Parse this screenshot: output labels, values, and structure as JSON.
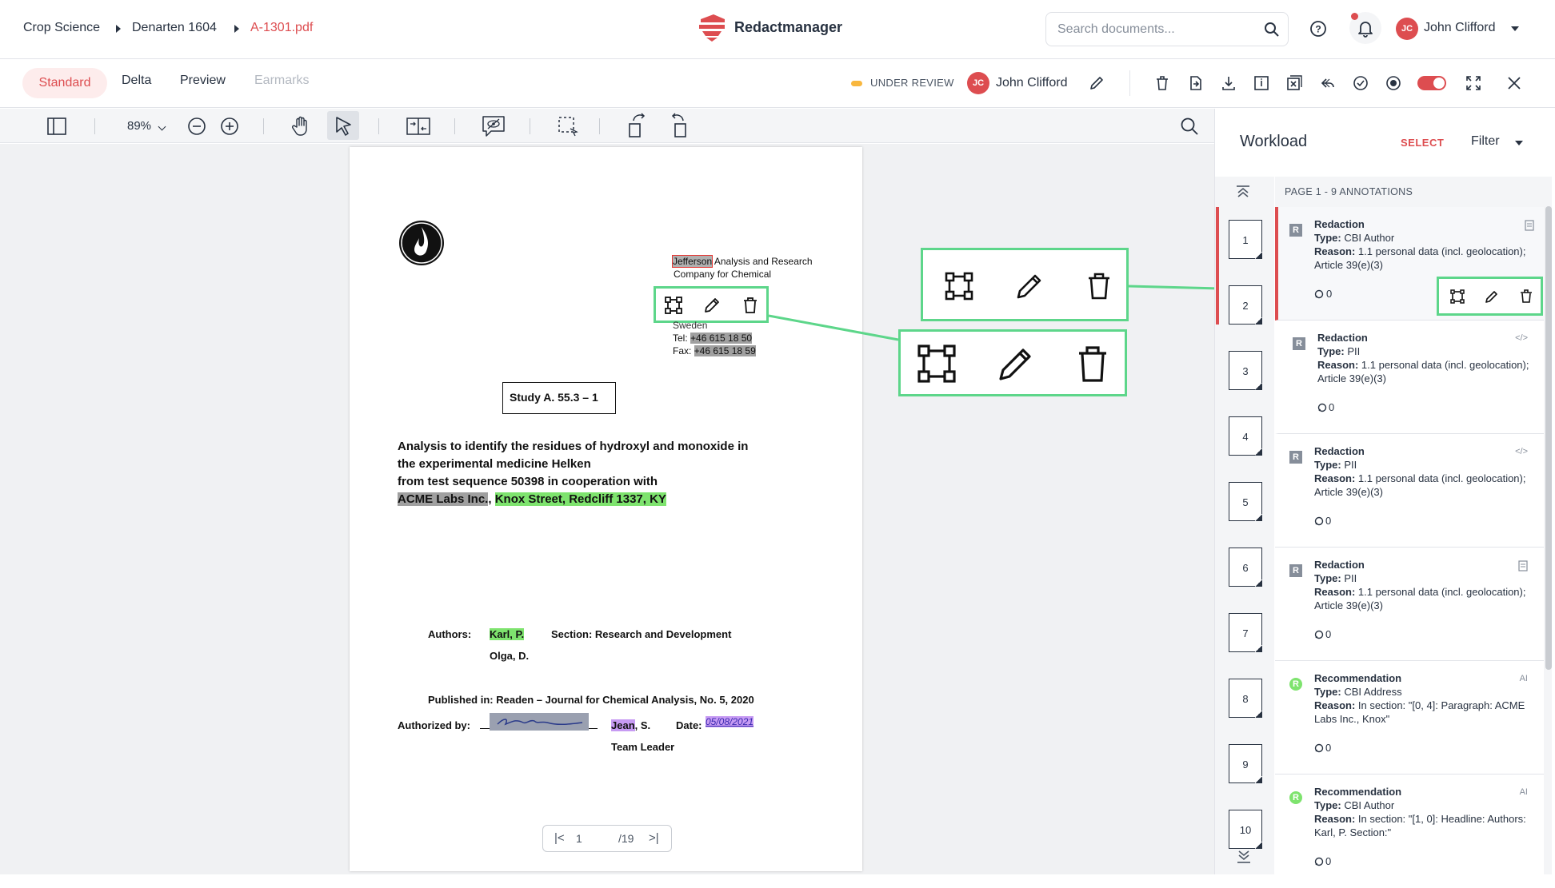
{
  "breadcrumb": {
    "items": [
      "Crop Science",
      "Denarten 1604",
      "A-1301.pdf"
    ]
  },
  "app": {
    "name": "Redactmanager"
  },
  "search": {
    "placeholder": "Search documents..."
  },
  "user": {
    "initials": "JC",
    "name": "John Clifford"
  },
  "tabs": [
    "Standard",
    "Delta",
    "Preview",
    "Earmarks"
  ],
  "status": {
    "label": "UNDER REVIEW",
    "color": "#f8b73e"
  },
  "assignee": {
    "initials": "JC",
    "name": "John Clifford"
  },
  "zoom": {
    "value": "89%"
  },
  "document": {
    "company_name_redacted": "Jefferson",
    "company_line1_rest": " Analysis and Research",
    "company_line2": "Company for Chemical",
    "country": "Sweden",
    "tel_label": "Tel: ",
    "tel_value": "+46 615 18 50",
    "fax_label": "Fax: ",
    "fax_value": "+46 615 18 59",
    "study_title": "Study A. 55.3 – 1",
    "heading_line1": "Analysis to identify the residues of hydroxyl and monoxide in",
    "heading_line2": "the experimental medicine Helken",
    "heading_line3": "from test sequence 50398 in cooperation with",
    "lab_name": "ACME Labs Inc.",
    "lab_sep": ", ",
    "lab_address": "Knox Street, Redcliff 1337, KY",
    "authors_label": "Authors:",
    "author1": "Karl, P.",
    "author2": "Olga, D.",
    "section_label": "Section: Research and Development",
    "published": "Published in: Readen – Journal for Chemical Analysis, No. 5, 2020",
    "authorized_label": "Authorized by:",
    "signer_name": "Jean",
    "signer_suffix": ", S.",
    "date_label": "Date:",
    "date_value": "05/08/2021",
    "team_leader": "Team Leader",
    "page_current": "1",
    "page_total": "/19"
  },
  "panel": {
    "title": "Workload",
    "select_label": "SELECT",
    "filter_label": "Filter",
    "list_header": "PAGE 1 - 9 ANNOTATIONS",
    "pages": [
      "1",
      "2",
      "3",
      "4",
      "5",
      "6",
      "7",
      "8",
      "9",
      "10"
    ],
    "annotations": [
      {
        "badge": "R",
        "title": "Redaction",
        "type_label": "Type:",
        "type": " CBI Author",
        "reason_label": "Reason:",
        "reason": " 1.1 personal data (incl. geolocation); Article 39(e)(3)",
        "comments": "0",
        "corner": ""
      },
      {
        "badge": "R",
        "title": "Redaction",
        "type_label": "Type:",
        "type": " PII",
        "reason_label": "Reason:",
        "reason": " 1.1 personal data (incl. geolocation); Article 39(e)(3)",
        "comments": "0",
        "corner": ""
      },
      {
        "badge": "R",
        "title": "Redaction",
        "type_label": "Type:",
        "type": " PII",
        "reason_label": "Reason:",
        "reason": " 1.1 personal data (incl. geolocation); Article 39(e)(3)",
        "comments": "0",
        "corner": ""
      },
      {
        "badge": "R",
        "title": "Redaction",
        "type_label": "Type:",
        "type": " PII",
        "reason_label": "Reason:",
        "reason": " 1.1 personal data (incl. geolocation); Article 39(e)(3)",
        "comments": "0",
        "corner": ""
      },
      {
        "badge": "R",
        "title": "Recommendation",
        "type_label": "Type:",
        "type": " CBI Address",
        "reason_label": "Reason:",
        "reason": " In section: \"[0, 4]: Paragraph: ACME Labs Inc., Knox\"",
        "comments": "0",
        "corner": "AI"
      },
      {
        "badge": "R",
        "title": "Recommendation",
        "type_label": "Type:",
        "type": " CBI Author",
        "reason_label": "Reason:",
        "reason": " In section: \"[1, 0]: Headline: Authors: Karl, P. Section:\"",
        "comments": "0",
        "corner": "AI"
      }
    ]
  },
  "colors": {
    "brand_red": "#dd4d50",
    "highlight_green": "#7ee36e",
    "callout_green": "#5dd68a",
    "redaction_gray": "#a0a0a0",
    "recommendation_green": "#7ee36e",
    "toggle_red": "#dd4d50"
  },
  "icons": [
    "search-icon",
    "help-icon",
    "bell-icon",
    "chevron-down-icon",
    "edit-icon",
    "delete-icon",
    "download-icon",
    "close-icon",
    "fullscreen-icon",
    "zoom-in-icon",
    "zoom-out-icon",
    "hand-icon",
    "select-icon",
    "resize-icon",
    "comment-icon"
  ]
}
